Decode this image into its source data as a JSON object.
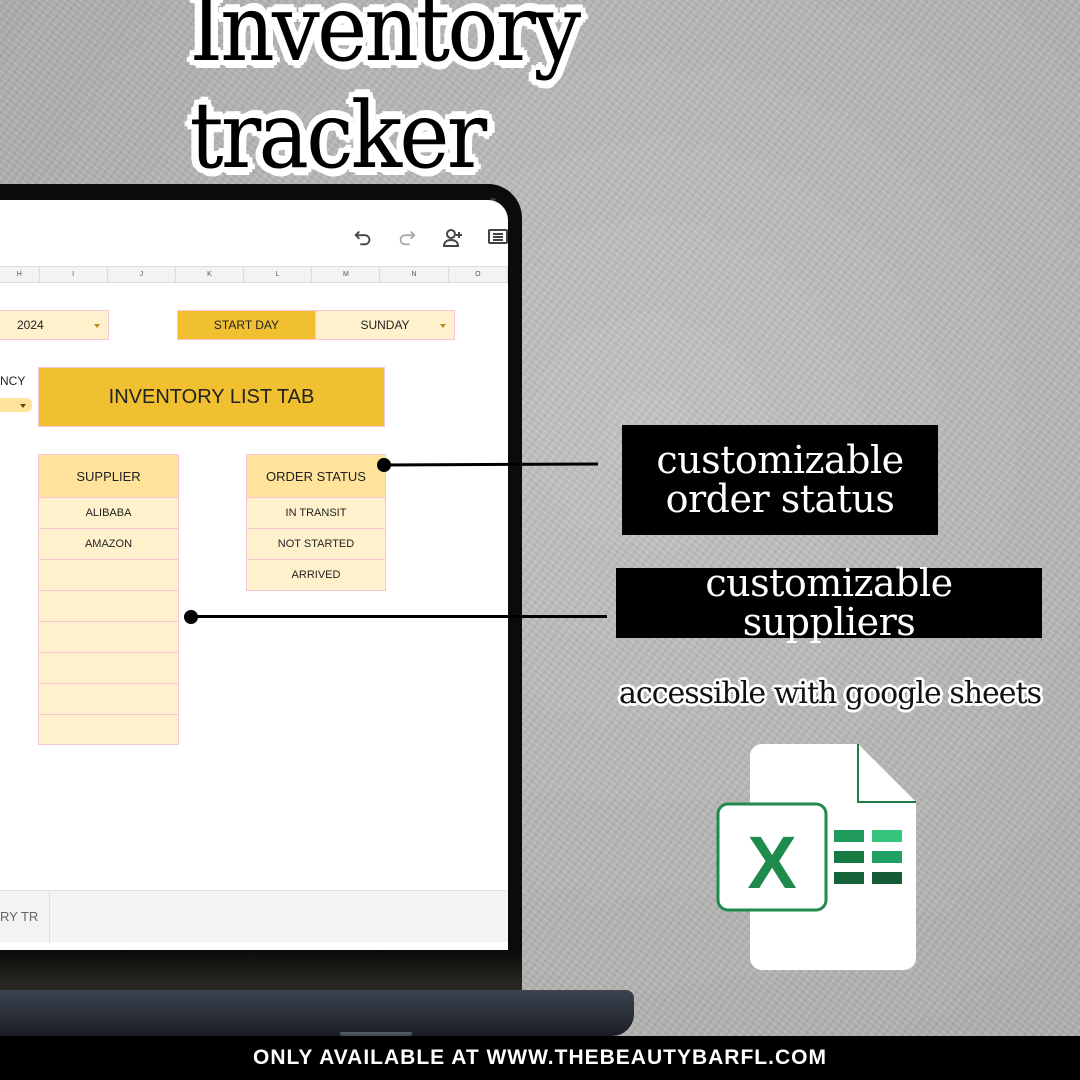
{
  "title": "Inventory tracker",
  "spreadsheet": {
    "toolbar": {
      "icons": [
        "undo-icon",
        "redo-icon",
        "share-add-person-icon",
        "comments-icon"
      ]
    },
    "columns": [
      "H",
      "I",
      "J",
      "K",
      "L",
      "M",
      "N",
      "O"
    ],
    "year_dropdown": {
      "value": "2024"
    },
    "start_day": {
      "label": "START DAY",
      "value": "SUNDAY"
    },
    "currency_label": "NCY",
    "banner": "INVENTORY LIST TAB",
    "supplier_table": {
      "header": "SUPPLIER",
      "rows": [
        "ALIBABA",
        "AMAZON",
        "",
        "",
        "",
        "",
        "",
        ""
      ]
    },
    "order_status_table": {
      "header": "ORDER STATUS",
      "rows": [
        "IN TRANSIT",
        "NOT STARTED",
        "ARRIVED"
      ]
    },
    "sheet_tab": "RY TR"
  },
  "callouts": {
    "order_status": "customizable order status",
    "suppliers": "customizable suppliers",
    "accessible": "accessible with google sheets"
  },
  "footer": "ONLY AVAILABLE AT WWW.THEBEAUTYBARFL.COM",
  "colors": {
    "accent_gold": "#f0c030",
    "cell_light": "#fff1cc",
    "cell_header": "#ffe39a",
    "cell_border": "#f4c7d2",
    "excel_green": "#1e7d45"
  }
}
